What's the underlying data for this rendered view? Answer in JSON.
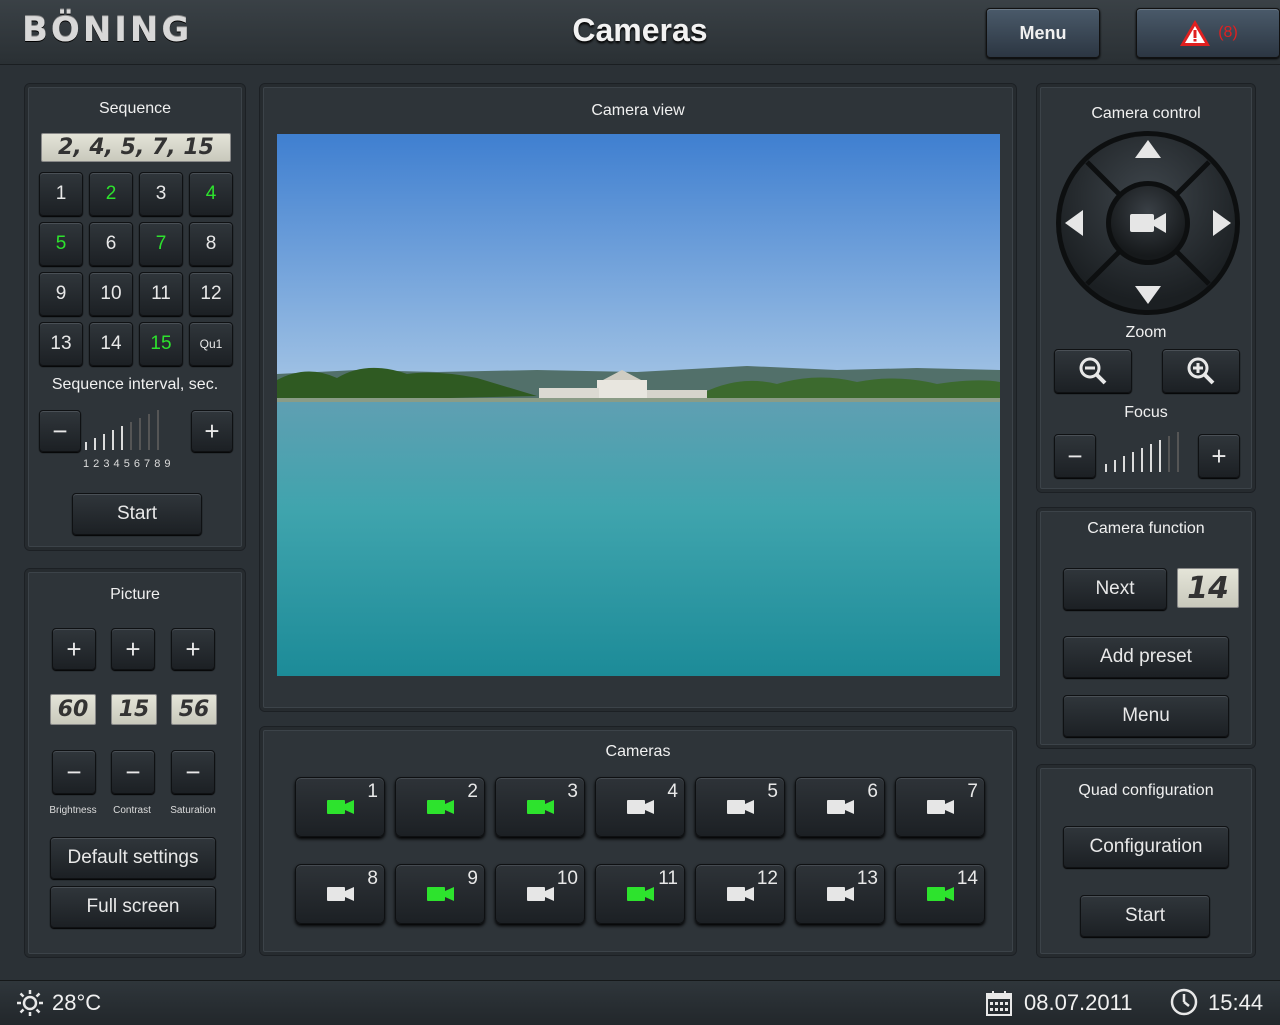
{
  "header": {
    "logo": "BÖNING",
    "title": "Cameras",
    "menu_label": "Menu",
    "alarm_count": "(8)"
  },
  "sequence": {
    "title": "Sequence",
    "display": "2, 4, 5, 7, 15",
    "buttons": [
      {
        "label": "1",
        "active": false
      },
      {
        "label": "2",
        "active": true
      },
      {
        "label": "3",
        "active": false
      },
      {
        "label": "4",
        "active": true
      },
      {
        "label": "5",
        "active": true
      },
      {
        "label": "6",
        "active": false
      },
      {
        "label": "7",
        "active": true
      },
      {
        "label": "8",
        "active": false
      },
      {
        "label": "9",
        "active": false
      },
      {
        "label": "10",
        "active": false
      },
      {
        "label": "11",
        "active": false
      },
      {
        "label": "12",
        "active": false
      },
      {
        "label": "13",
        "active": false
      },
      {
        "label": "14",
        "active": false
      },
      {
        "label": "15",
        "active": true
      },
      {
        "label": "Qu1",
        "active": false
      }
    ],
    "interval_label": "Sequence interval, sec.",
    "interval_minus": "−",
    "interval_plus": "+",
    "interval_scale": "1 2 3 4 5 6 7 8 9",
    "interval_level": 5,
    "interval_max": 9,
    "start_label": "Start"
  },
  "picture": {
    "title": "Picture",
    "plus": "+",
    "minus": "−",
    "brightness_value": "60",
    "contrast_value": "15",
    "saturation_value": "56",
    "brightness_label": "Brightness",
    "contrast_label": "Contrast",
    "saturation_label": "Saturation",
    "default_label": "Default settings",
    "fullscreen_label": "Full screen"
  },
  "camera_view": {
    "title": "Camera view"
  },
  "cameras": {
    "title": "Cameras",
    "list": [
      {
        "num": "1",
        "active": true
      },
      {
        "num": "2",
        "active": true
      },
      {
        "num": "3",
        "active": true
      },
      {
        "num": "4",
        "active": false
      },
      {
        "num": "5",
        "active": false
      },
      {
        "num": "6",
        "active": false
      },
      {
        "num": "7",
        "active": false
      },
      {
        "num": "8",
        "active": false
      },
      {
        "num": "9",
        "active": true
      },
      {
        "num": "10",
        "active": false
      },
      {
        "num": "11",
        "active": true
      },
      {
        "num": "12",
        "active": false
      },
      {
        "num": "13",
        "active": false
      },
      {
        "num": "14",
        "active": true
      }
    ]
  },
  "camera_control": {
    "title": "Camera control",
    "zoom_label": "Zoom",
    "focus_label": "Focus",
    "focus_minus": "−",
    "focus_plus": "+",
    "focus_level": 7,
    "focus_max": 9
  },
  "camera_function": {
    "title": "Camera function",
    "next_label": "Next",
    "preset_number": "14",
    "add_preset_label": "Add preset",
    "menu_label": "Menu"
  },
  "quad": {
    "title": "Quad configuration",
    "config_label": "Configuration",
    "start_label": "Start"
  },
  "status": {
    "temperature": "28°C",
    "date": "08.07.2011",
    "time": "15:44"
  },
  "colors": {
    "active_green": "#2de32d",
    "alarm_red": "#e02020"
  }
}
